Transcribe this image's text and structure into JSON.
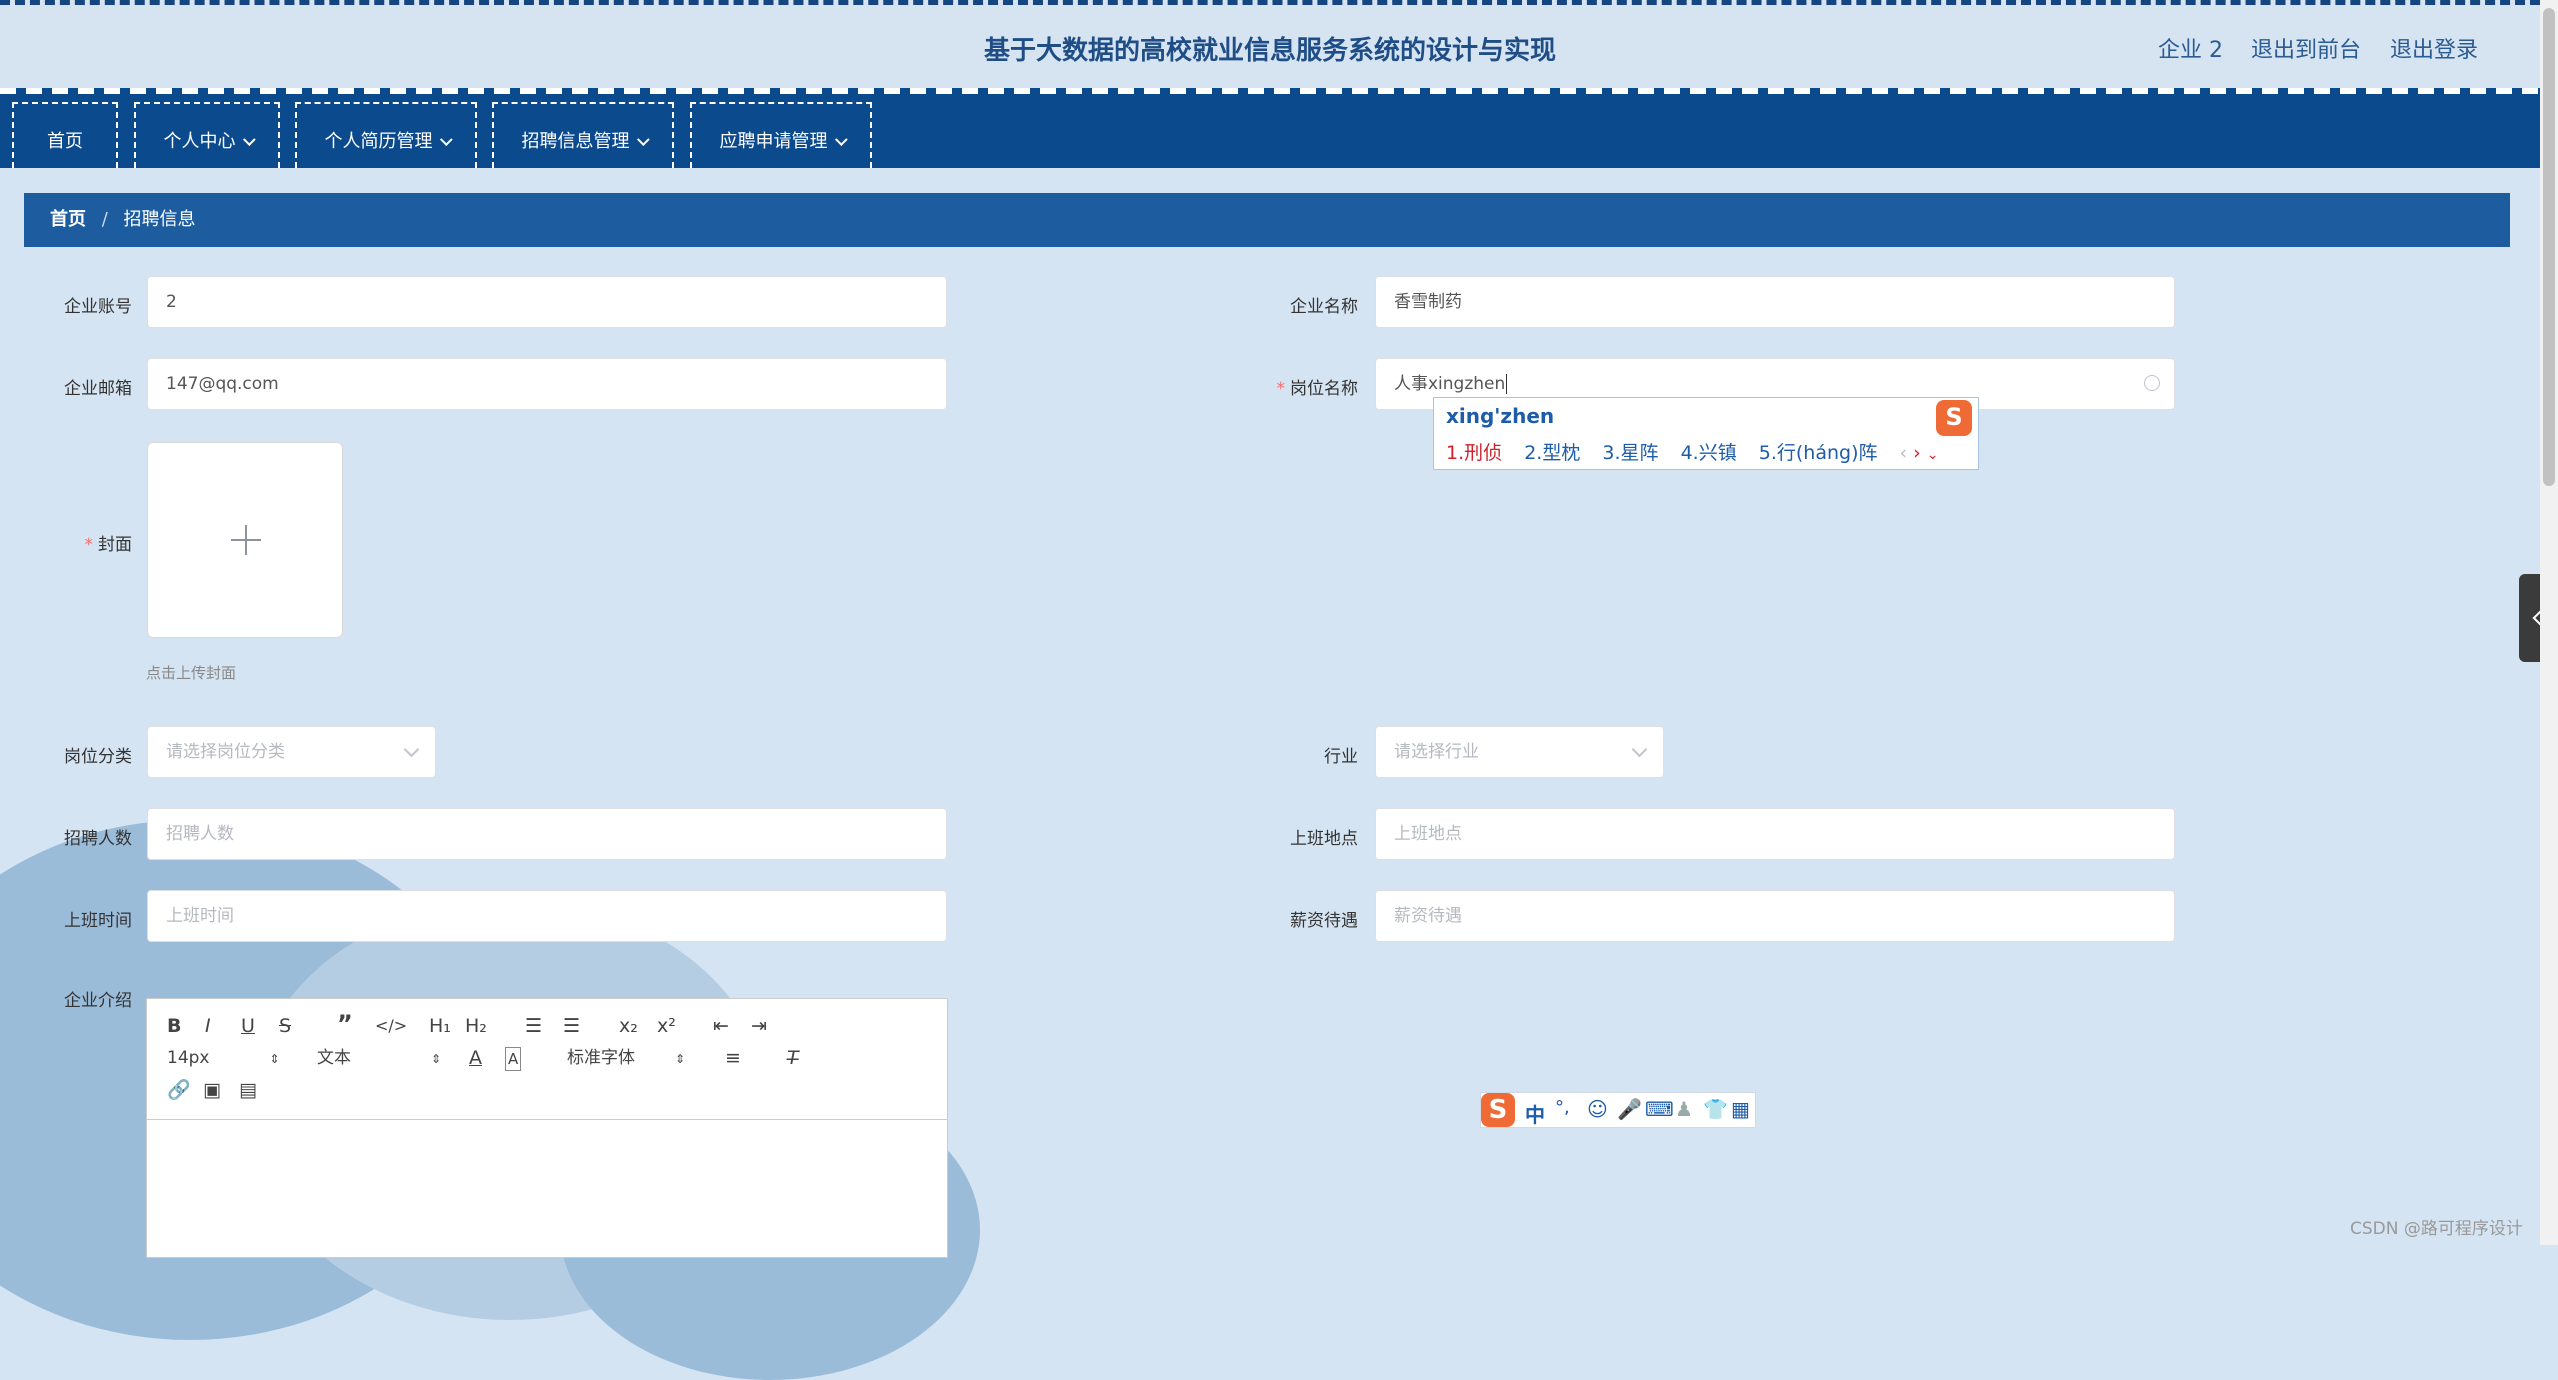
{
  "header": {
    "title": "基于大数据的高校就业信息服务系统的设计与实现",
    "user": "企业 2",
    "front": "退出到前台",
    "logout": "退出登录"
  },
  "nav": [
    {
      "label": "首页",
      "dropdown": false
    },
    {
      "label": "个人中心",
      "dropdown": true
    },
    {
      "label": "个人简历管理",
      "dropdown": true
    },
    {
      "label": "招聘信息管理",
      "dropdown": true
    },
    {
      "label": "应聘申请管理",
      "dropdown": true
    }
  ],
  "breadcrumb": {
    "home": "首页",
    "sep": "/",
    "current": "招聘信息"
  },
  "form": {
    "company_account": {
      "label": "企业账号",
      "value": "2"
    },
    "company_name": {
      "label": "企业名称",
      "value": "香雪制药"
    },
    "company_email": {
      "label": "企业邮箱",
      "value": "147@qq.com"
    },
    "position_name": {
      "label": "岗位名称",
      "value": "人事xingzhen"
    },
    "cover": {
      "label": "封面",
      "hint": "点击上传封面"
    },
    "position_category": {
      "label": "岗位分类",
      "placeholder": "请选择岗位分类"
    },
    "industry": {
      "label": "行业",
      "placeholder": "请选择行业"
    },
    "headcount": {
      "label": "招聘人数",
      "placeholder": "招聘人数"
    },
    "location": {
      "label": "上班地点",
      "placeholder": "上班地点"
    },
    "work_time": {
      "label": "上班时间",
      "placeholder": "上班时间"
    },
    "salary": {
      "label": "薪资待遇",
      "placeholder": "薪资待遇"
    },
    "intro": {
      "label": "企业介绍"
    }
  },
  "editor": {
    "font_size": "14px",
    "header_select": "文本",
    "font_select": "标准字体"
  },
  "ime": {
    "pinyin": "xing'zhen",
    "candidates": [
      "1.刑侦",
      "2.型枕",
      "3.星阵",
      "4.兴镇",
      "5.行(háng)阵"
    ],
    "bar_mode": "中"
  },
  "watermark": "CSDN @路可程序设计"
}
